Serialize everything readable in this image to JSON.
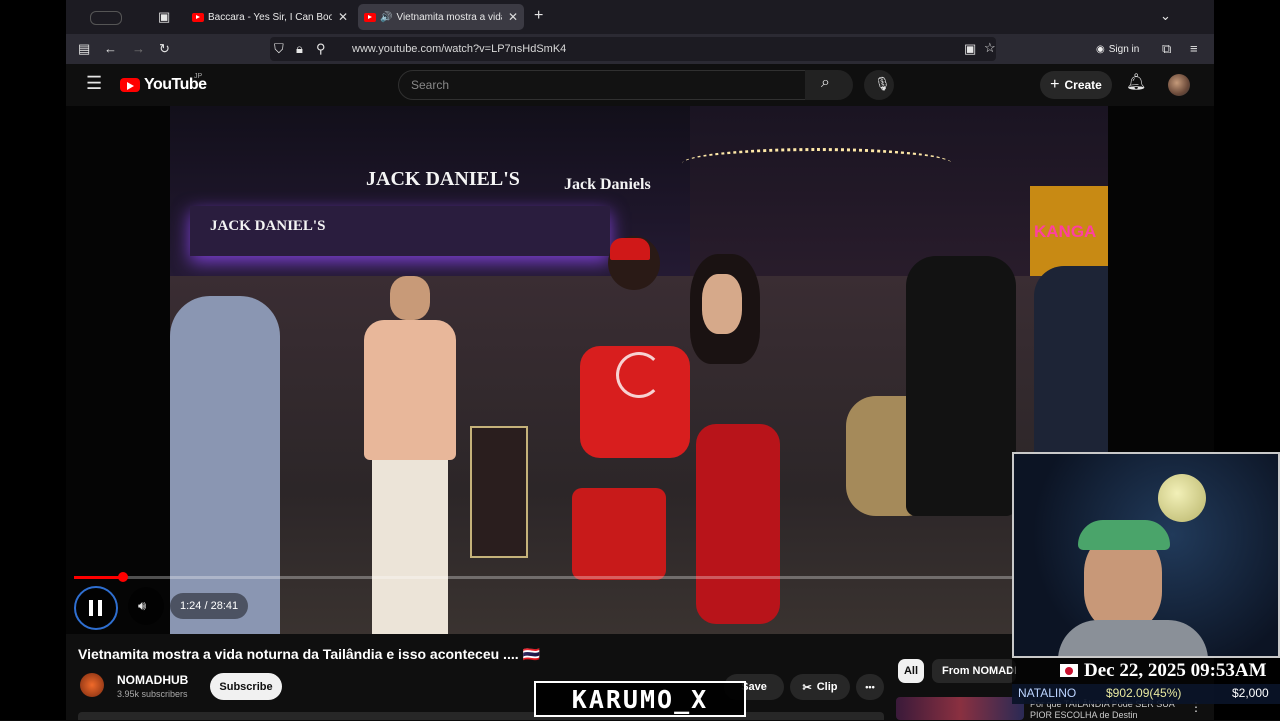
{
  "tabs": [
    {
      "title": "Baccara - Yes Sir, I Can Boogie"
    },
    {
      "title": "Vietnamita mostra a vida noturna"
    }
  ],
  "url": "www.youtube.com/watch?v=LP7nsHdSmK4",
  "sign_in": "Sign in",
  "youtube": {
    "logo": "YouTube",
    "region": "JP",
    "search_placeholder": "Search",
    "create": "Create"
  },
  "video": {
    "signs": [
      "JACK DANIEL'S",
      "JACK DANIEL'S",
      "Jack Daniels",
      "KANGA"
    ],
    "time": "1:24 / 28:41",
    "progress": 0.049
  },
  "title": "Vietnamita mostra a vida noturna da Tailândia e isso aconteceu .... 🇹🇭",
  "channel": {
    "name": "NOMADHUB",
    "subscribers": "3.95k subscribers",
    "subscribe": "Subscribe"
  },
  "actions": {
    "save": "Save",
    "clip": "Clip",
    "more": "•••"
  },
  "chips": [
    "All",
    "From NOMADH"
  ],
  "recommendation": "Por que TAILÂNDIA Pode SER SUA PIOR ESCOLHA de Destin",
  "overlay": {
    "date": "Dec 22, 2025 09:53AM",
    "donor": "NATALINO",
    "amount": "$902.09(45%)",
    "goal": "$2,000",
    "watermark": "KARUMO_X"
  }
}
